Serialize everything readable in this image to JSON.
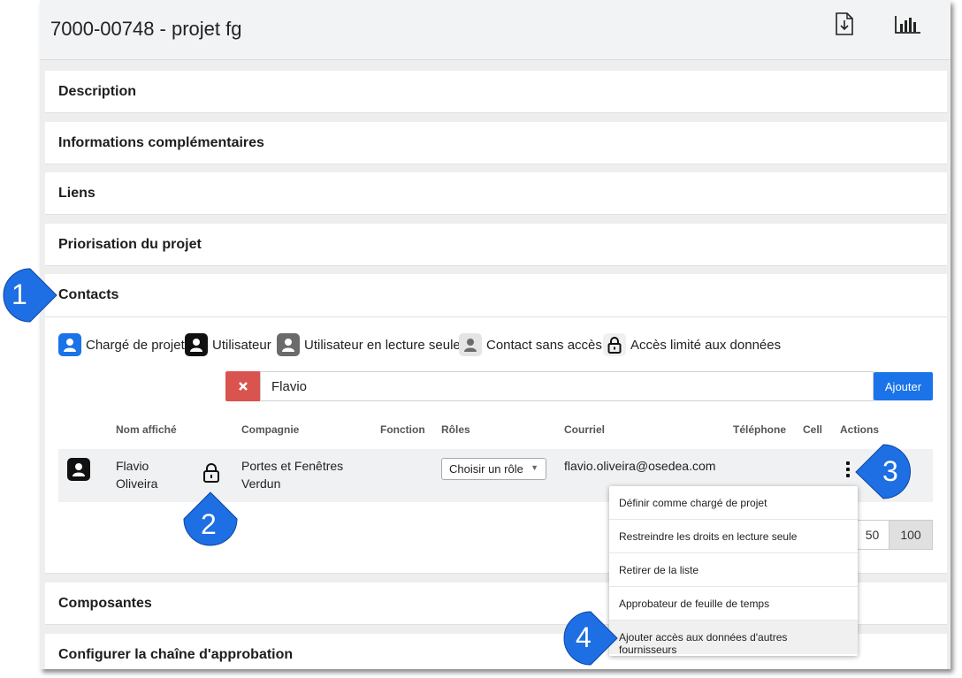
{
  "header": {
    "title": "7000-00748 - projet fg",
    "download_icon": "file-download-icon",
    "chart_icon": "bar-chart-icon"
  },
  "sections": {
    "description": "Description",
    "informations": "Informations complémentaires",
    "liens": "Liens",
    "priorisation": "Priorisation du projet",
    "contacts": "Contacts",
    "composantes": "Composantes",
    "chaine": "Configurer la chaîne d'approbation"
  },
  "legend": {
    "project_manager": "Chargé de projet",
    "user": "Utilisateur",
    "read_only_user": "Utilisateur en lecture seule",
    "no_access_contact": "Contact sans accès",
    "limited_access": "Accès limité aux données"
  },
  "search": {
    "value": "Flavio",
    "add_label": "Ajouter"
  },
  "table": {
    "headers": {
      "name": "Nom affiché",
      "company": "Compagnie",
      "function": "Fonction",
      "roles": "Rôles",
      "email": "Courriel",
      "phone": "Téléphone",
      "cell": "Cell",
      "actions": "Actions"
    },
    "row": {
      "first_name": "Flavio",
      "last_name": "Oliveira",
      "company_line1": "Portes et Fenêtres",
      "company_line2": "Verdun",
      "role_select": "Choisir un rôle",
      "email": "flavio.oliveira@osedea.com"
    }
  },
  "pagination": {
    "option_50": "50",
    "option_100": "100"
  },
  "actions_menu": {
    "items": [
      "Définir comme chargé de projet",
      "Restreindre les droits en lecture seule",
      "Retirer de la liste",
      "Approbateur de feuille de temps",
      "Ajouter accès aux données d'autres fournisseurs"
    ]
  },
  "callouts": [
    "1",
    "2",
    "3",
    "4"
  ],
  "colors": {
    "accent_blue": "#1a73e8",
    "callout_blue": "#1d6fe3",
    "danger_red": "#d9534f"
  }
}
